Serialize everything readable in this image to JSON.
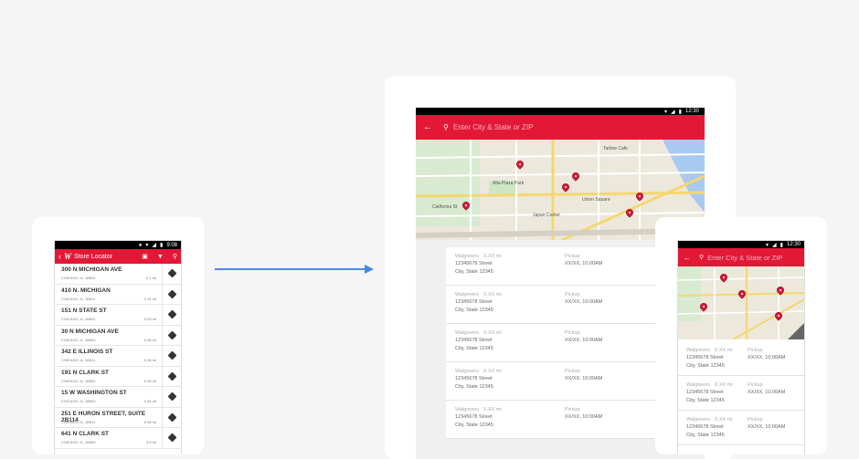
{
  "phone": {
    "status_time": "9:08",
    "title": "Store Locator",
    "stores": [
      {
        "address": "300 N MICHIGAN AVE",
        "city": "CHICAGO, IL, 60601",
        "distance": "0.1 mi"
      },
      {
        "address": "410 N. MICHIGAN",
        "city": "CHICAGO, IL, 60611",
        "distance": "0.11 mi"
      },
      {
        "address": "151 N STATE ST",
        "city": "CHICAGO, IL, 60601",
        "distance": "0.33 mi"
      },
      {
        "address": "30 N MICHIGAN AVE",
        "city": "CHICAGO, IL, 60602",
        "distance": "0.36 mi"
      },
      {
        "address": "342 E ILLINOIS ST",
        "city": "CHICAGO, IL, 60611",
        "distance": "0.38 mi"
      },
      {
        "address": "191 N CLARK ST",
        "city": "CHICAGO, IL, 60601",
        "distance": "0.39 mi"
      },
      {
        "address": "15 W WASHINGTON ST",
        "city": "CHICAGO, IL, 60602",
        "distance": "0.44 mi"
      },
      {
        "address": "251 E HURON STREET, SUITE 2B114",
        "city": "CHICAGO, IL, 60611",
        "distance": "0.48 mi"
      },
      {
        "address": "641 N CLARK ST",
        "city": "CHICAGO, IL, 60654",
        "distance": "0.5 mi"
      }
    ]
  },
  "tablet": {
    "status_time": "12:30",
    "search_placeholder": "Enter City & State or ZIP",
    "map_labels": {
      "park": "Alta Plaza Park",
      "california": "California St",
      "union_square": "Union Square",
      "japantown": "Japan Center",
      "cafe": "Tartine Cafe"
    },
    "results": [
      {
        "name": "Walgreens",
        "dist": "X.XX mi",
        "street": "12345678 Street",
        "city": "City, State 12345",
        "pickup_label": "Pickup",
        "pickup_time": "XX/XX, 10:00AM"
      },
      {
        "name": "Walgreens",
        "dist": "X.XX mi",
        "street": "12345678 Street",
        "city": "City, State 12345",
        "pickup_label": "Pickup",
        "pickup_time": "XX/XX, 10:00AM"
      },
      {
        "name": "Walgreens",
        "dist": "X.XX mi",
        "street": "12345678 Street",
        "city": "City, State 12345",
        "pickup_label": "Pickup",
        "pickup_time": "XX/XX, 10:00AM"
      },
      {
        "name": "Walgreens",
        "dist": "X.XX mi",
        "street": "12345678 Street",
        "city": "City, State 12345",
        "pickup_label": "Pickup",
        "pickup_time": "XX/XX, 10:00AM"
      },
      {
        "name": "Walgreens",
        "dist": "X.XX mi",
        "street": "12345678 Street",
        "city": "City, State 12345",
        "pickup_label": "Pickup",
        "pickup_time": "XX/XX, 10:00AM"
      }
    ]
  },
  "small_phone": {
    "status_time": "12:30",
    "search_placeholder": "Enter City & State or ZIP",
    "results": [
      {
        "name": "Walgreens",
        "dist": "X.XX mi",
        "street": "12345678 Street",
        "city": "City, State 12345",
        "pickup_label": "Pickup",
        "pickup_time": "XX/XX, 10:00AM"
      },
      {
        "name": "Walgreens",
        "dist": "X.XX mi",
        "street": "12345678 Street",
        "city": "City, State 12345",
        "pickup_label": "Pickup",
        "pickup_time": "XX/XX, 10:00AM"
      },
      {
        "name": "Walgreens",
        "dist": "X.XX mi",
        "street": "12345678 Street",
        "city": "City, State 12345",
        "pickup_label": "Pickup",
        "pickup_time": "XX/XX, 10:00AM"
      }
    ]
  },
  "colors": {
    "brand_red": "#e31837",
    "arrow_blue": "#4a86e8"
  }
}
